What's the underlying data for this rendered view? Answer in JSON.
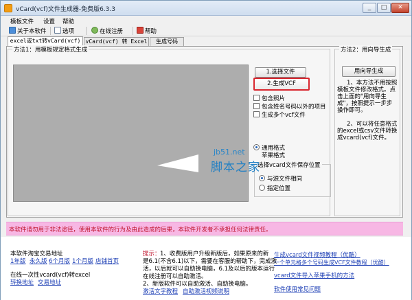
{
  "window": {
    "title": "vCard(vcf)文件生成器-免费版6.3.3",
    "minimize_glyph": "_",
    "maximize_glyph": "□",
    "close_glyph": "✕"
  },
  "menu": [
    "模板文件",
    "设置",
    "帮助"
  ],
  "toolbar": {
    "about": "关于本软件",
    "options": "选项",
    "online_register": "在线注册",
    "help": "帮助"
  },
  "tabs": [
    "excel或txt转vCard(vcf)",
    "vCard(vcf) 转 Excel",
    "生成号码"
  ],
  "left_panel": {
    "group_title": "方法1：用模板规定格式生成",
    "select_file_button": "1.选择文件",
    "generate_button": "2.生成VCF",
    "options": [
      "包含照片",
      "包含姓名号码以外的项目",
      "生成多个vcf文件"
    ],
    "format_options": [
      {
        "label": "通用格式",
        "selected": true
      },
      {
        "label": "苹果格式",
        "selected": false
      }
    ],
    "save_location": {
      "title": "选择vcard文件保存位置",
      "options": [
        {
          "label": "与源文件相同",
          "selected": true
        },
        {
          "label": "指定位置",
          "selected": false
        }
      ]
    }
  },
  "right_panel": {
    "group_title": "方法2：用向导生成",
    "wizard_button": "用向导生成",
    "paragraph1": "1、本方法不用按照模板文件修改格式。点击上面的\"用向导生成\"，按照提示一步步操作即可。",
    "paragraph2": "2、可以将任意格式的excel或csv文件转换成vcard(vcf)文件。"
  },
  "watermark": {
    "url": "jb51.net",
    "text": "脚本之家"
  },
  "warning": "本软件请勿用于非法途径，使用本软件的行为及由此造成的后果，本软件开发者不承担任何法律责任。",
  "bottom": {
    "taobao_title": "本软件淘宝交易地址",
    "taobao_links": [
      "1年版",
      "永久版",
      "6个月版",
      "1个月版",
      "店铺首页"
    ],
    "convert_title": "在线一次性vcard(vcf)转excel",
    "convert_links": [
      "转换地址",
      "交易地址"
    ],
    "tip_label": "提示：",
    "tip_lines": [
      "1、收费版用户升级新版后，如果原来的新",
      "是6.1(不含6.1)以下，需要在客服的帮助下，完成激",
      "活，以后就可以自助换电脑，6.1及以后的版本运行",
      "在线注册可以自助激活。",
      "2、新版软件可以自助激活、自助换电脑。"
    ],
    "tip_links": [
      "激活文字教程",
      "自助激活视频说明"
    ],
    "tutorials": [
      "生成vcard文件视频教程（优酷）",
      "一个单元格多个号码生成VCF文件教程（优酷）",
      "vcard文件导入苹果手机的方法",
      "软件使用常见问题"
    ]
  },
  "colors": {
    "title_gradient": "#cfddef",
    "warning_background": "#f7b7e4",
    "warning_text": "#c0152e",
    "link": "#1d3fb5",
    "highlight_border": "#d9262e",
    "preview_area": "#adadad"
  }
}
